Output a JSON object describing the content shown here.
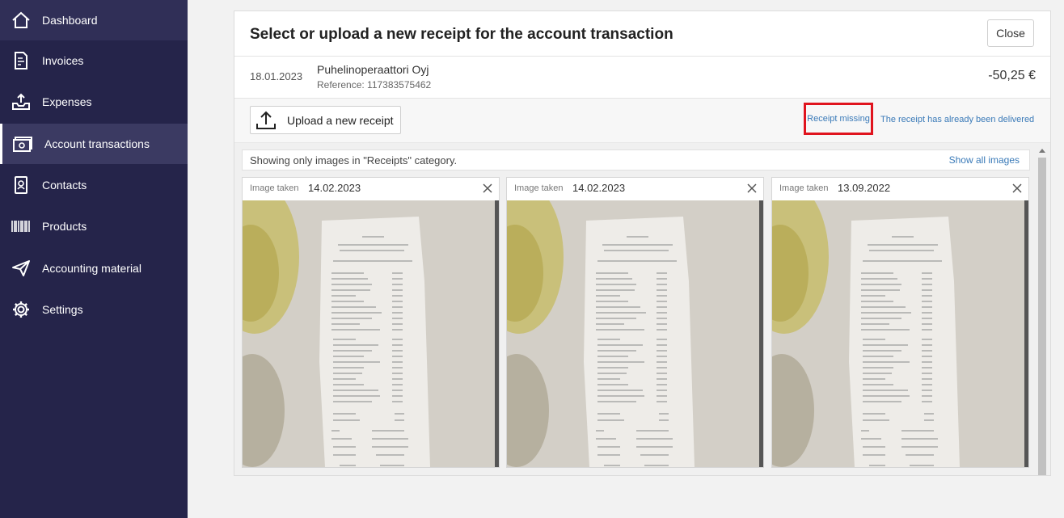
{
  "sidebar": {
    "items": [
      {
        "label": "Dashboard",
        "icon": "home-icon"
      },
      {
        "label": "Invoices",
        "icon": "invoice-icon"
      },
      {
        "label": "Expenses",
        "icon": "tray-upload-icon"
      },
      {
        "label": "Account transactions",
        "icon": "banknotes-icon"
      },
      {
        "label": "Contacts",
        "icon": "contact-card-icon"
      },
      {
        "label": "Products",
        "icon": "barcode-icon"
      },
      {
        "label": "Accounting material",
        "icon": "paper-plane-icon"
      },
      {
        "label": "Settings",
        "icon": "gear-icon"
      }
    ],
    "active": "Account transactions"
  },
  "modal": {
    "title": "Select or upload a new receipt for the account transaction",
    "close_label": "Close",
    "transaction": {
      "date": "18.01.2023",
      "name": "Puhelinoperaattori Oyj",
      "reference": "Reference: 117383575462",
      "amount": "-50,25 €"
    },
    "actions": {
      "upload_label": "Upload a new receipt",
      "receipt_missing": "Receipt missing",
      "already_delivered": "The receipt has already been delivered"
    },
    "gallery": {
      "filter_text": "Showing only images in \"Receipts\" category.",
      "show_all": "Show all images",
      "cards": [
        {
          "label": "Image taken",
          "date": "14.02.2023"
        },
        {
          "label": "Image taken",
          "date": "14.02.2023"
        },
        {
          "label": "Image taken",
          "date": "13.09.2022"
        }
      ]
    }
  },
  "colors": {
    "sidebar_bg": "#25244a",
    "link": "#3a7ab8",
    "highlight_border": "#e0141e"
  }
}
